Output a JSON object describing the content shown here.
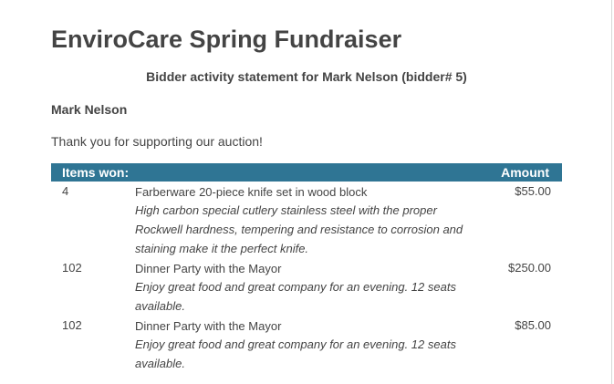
{
  "header": {
    "title": "EnviroCare Spring Fundraiser",
    "subtitle": "Bidder activity statement for Mark Nelson (bidder# 5)"
  },
  "bidder": {
    "name": "Mark Nelson",
    "message": "Thank you for supporting our auction!"
  },
  "table": {
    "col_items": "Items won:",
    "col_amount": "Amount",
    "header_color": "#2f7594",
    "rows": [
      {
        "number": "4",
        "name": "Farberware 20-piece knife set in wood block",
        "description": "High carbon special cutlery stainless steel with the proper Rockwell hardness, tempering and resistance to corrosion and staining make it the perfect knife.",
        "amount": "$55.00"
      },
      {
        "number": "102",
        "name": "Dinner Party with the Mayor",
        "description": "Enjoy great food and great company for an evening. 12 seats available.",
        "amount": "$250.00"
      },
      {
        "number": "102",
        "name": "Dinner Party with the Mayor",
        "description": "Enjoy great food and great company for an evening. 12 seats available.",
        "amount": "$85.00"
      }
    ]
  }
}
